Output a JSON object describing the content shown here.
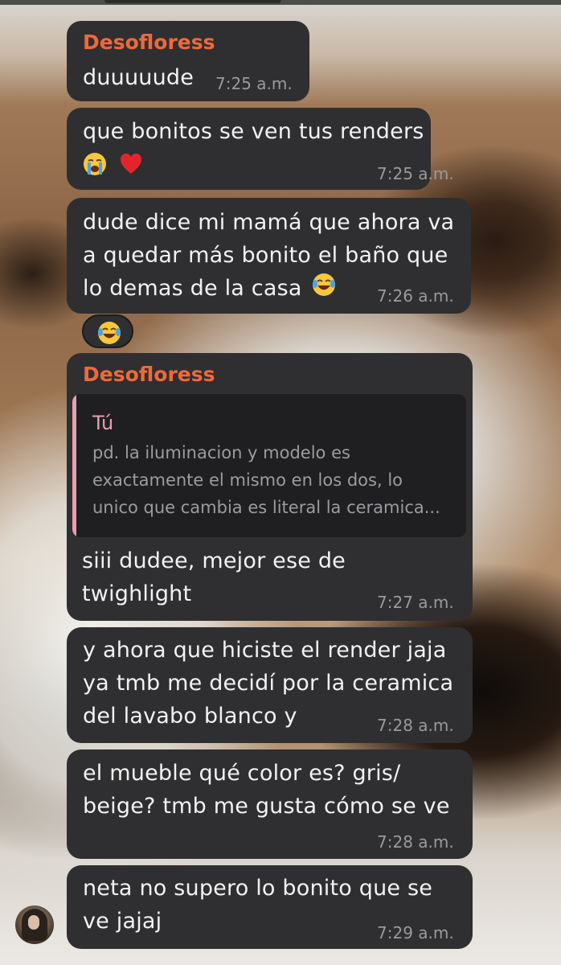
{
  "chat": {
    "messages": [
      {
        "sender": "Desofloress",
        "text": "duuuuude",
        "time": "7:25 a.m."
      },
      {
        "text": "que bonitos se ven tus renders",
        "emojis": [
          "loudly-crying-face",
          "red-heart"
        ],
        "time": "7:25 a.m."
      },
      {
        "text": "dude dice mi mamá que ahora va\na quedar más bonito el baño que\nlo demas de la casa",
        "emoji": "face-with-tears-of-joy",
        "time": "7:26 a.m.",
        "reaction": "face-with-tears-of-joy"
      },
      {
        "sender": "Desofloress",
        "reply": {
          "name": "Tú",
          "text": "pd. la iluminacion y modelo es\nexactamente el mismo en los dos, lo\nunico que cambia es literal la ceramica..."
        },
        "text": "siii dudee, mejor ese de\ntwighlight",
        "time": "7:27 a.m."
      },
      {
        "text": "y ahora que hiciste el render jaja\nya tmb me decidí por la ceramica\ndel lavabo blanco y",
        "time": "7:28 a.m."
      },
      {
        "text": "el mueble qué color es? gris/\nbeige? tmb me gusta cómo se ve",
        "time": "7:28 a.m."
      },
      {
        "text": "neta no supero lo bonito que se\nve jajaj",
        "time": "7:29 a.m."
      }
    ]
  },
  "colors": {
    "bubble": "#2f2f31",
    "sender_name": "#ee6a3a",
    "reply_accent": "#e6a0b0",
    "timestamp": "#9a9a9c"
  }
}
